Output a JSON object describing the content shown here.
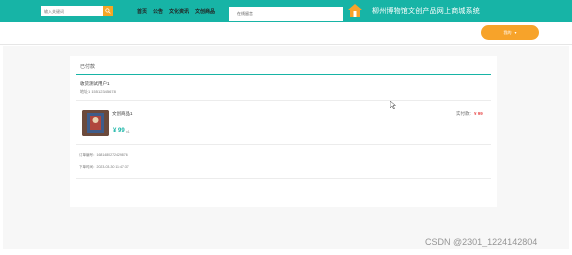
{
  "header": {
    "search_placeholder": "输入关键词",
    "notice_text": "在线留言",
    "site_title": "柳州博物馆文创产品网上商城系统"
  },
  "nav": {
    "links": [
      "首页",
      "公告",
      "文化资讯",
      "文创商品"
    ],
    "profile_button": "我的"
  },
  "order": {
    "section_title": "已付款",
    "recipient_name": "收货测试用户1",
    "recipient_phone": "地址1 15512345678",
    "product_name": "文创商品1",
    "price": "¥ 99",
    "quantity": "x1",
    "status_label": "实付款:",
    "total": "¥ 99",
    "order_number": "订单编号：1681480272429876",
    "order_time": "下单时间：2023-03-30 11:47:37"
  },
  "colors": {
    "accent": "#17b4a6",
    "button": "#f7a32a",
    "price_red": "#e84a4a"
  },
  "watermark": "CSDN @2301_1224142804"
}
